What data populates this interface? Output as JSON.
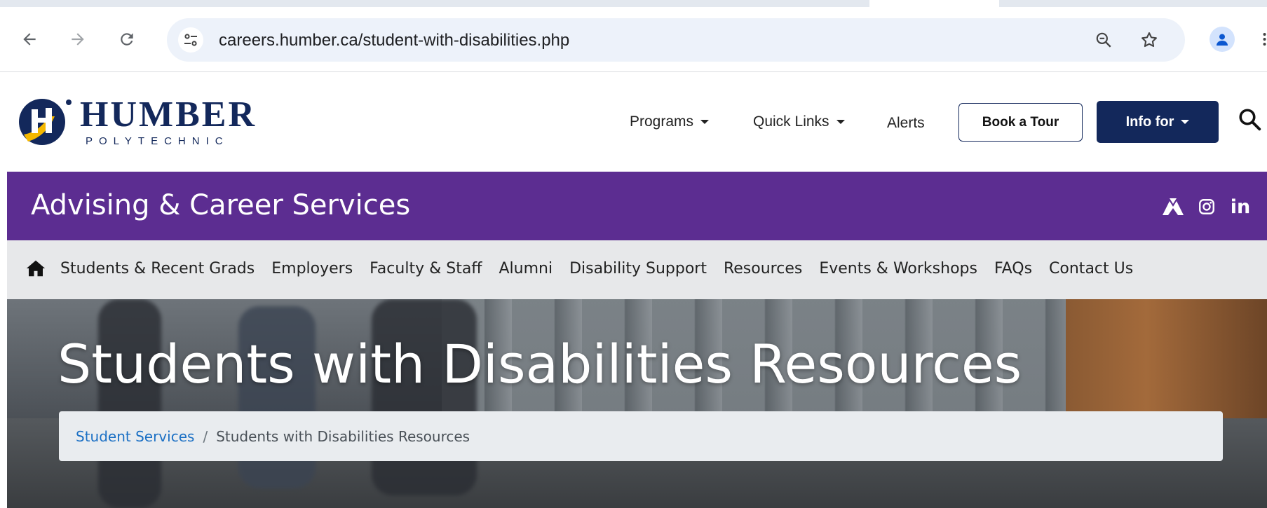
{
  "browser": {
    "url": "careers.humber.ca/student-with-disabilities.php",
    "back_icon": "arrow-left-icon",
    "forward_icon": "arrow-right-icon",
    "reload_icon": "reload-icon",
    "site_info_icon": "tune-icon",
    "zoom_icon": "zoom-out-icon",
    "bookmark_icon": "star-icon",
    "profile_icon": "person-icon"
  },
  "header": {
    "logo_word": "HUMBER",
    "logo_sub": "POLYTECHNIC",
    "nav": {
      "programs": "Programs",
      "quick_links": "Quick Links",
      "alerts": "Alerts"
    },
    "book_tour": "Book a Tour",
    "info_for": "Info for",
    "search_icon": "search-icon"
  },
  "banner": {
    "title": "Advising & Career Services",
    "social": [
      "humber-hawk-icon",
      "instagram-icon",
      "linkedin-icon"
    ],
    "linkedin_text": "in"
  },
  "subnav": {
    "home_icon": "home-icon",
    "items": [
      "Students & Recent Grads",
      "Employers",
      "Faculty & Staff",
      "Alumni",
      "Disability Support",
      "Resources",
      "Events & Workshops",
      "FAQs",
      "Contact Us"
    ]
  },
  "hero": {
    "title": "Students with Disabilities Resources",
    "breadcrumb": {
      "parent": "Student Services",
      "separator": "/",
      "current": "Students with Disabilities Resources"
    }
  },
  "colors": {
    "navy": "#13285b",
    "purple": "#5c2d91",
    "gold": "#f5b800",
    "link": "#1a6fc4",
    "omnibox": "#edf2fa"
  }
}
